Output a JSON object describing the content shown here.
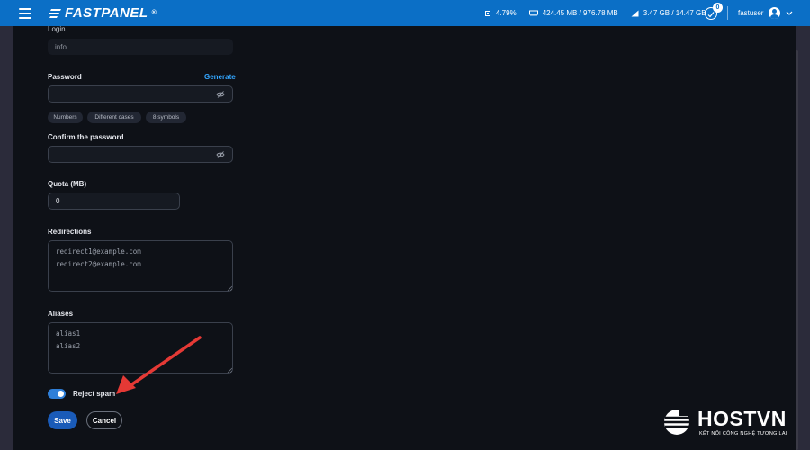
{
  "header": {
    "logo_text": "FASTPANEL",
    "logo_reg": "®",
    "cpu": "4.79%",
    "ram": "424.45 MB / 976.78 MB",
    "disk": "3.47 GB / 14.47 GB",
    "notifications_count": "0",
    "username": "fastuser",
    "accent_color": "#0b6fc6"
  },
  "form": {
    "login_label": "Login",
    "login_value": "info",
    "password_label": "Password",
    "generate_label": "Generate",
    "password_value": "",
    "hints": [
      "Numbers",
      "Different cases",
      "8 symbols"
    ],
    "confirm_label": "Confirm the password",
    "confirm_value": "",
    "quota_label": "Quota (MB)",
    "quota_value": "0",
    "redirections_label": "Redirections",
    "redirections_placeholder": "redirect1@example.com\nredirect2@example.com",
    "aliases_label": "Aliases",
    "aliases_placeholder": "alias1\nalias2",
    "reject_spam_label": "Reject spam",
    "reject_spam_on": true,
    "save_label": "Save",
    "cancel_label": "Cancel"
  },
  "watermark": {
    "brand": "HOSTVN",
    "tagline": "KẾT NỐI CÔNG NGHỆ TƯƠNG LAI"
  },
  "icons": [
    "menu-icon",
    "cpu-icon",
    "ram-icon",
    "disk-icon",
    "bell-icon",
    "user-icon",
    "chevron-down-icon",
    "eye-off-icon",
    "resize-grip-icon"
  ]
}
